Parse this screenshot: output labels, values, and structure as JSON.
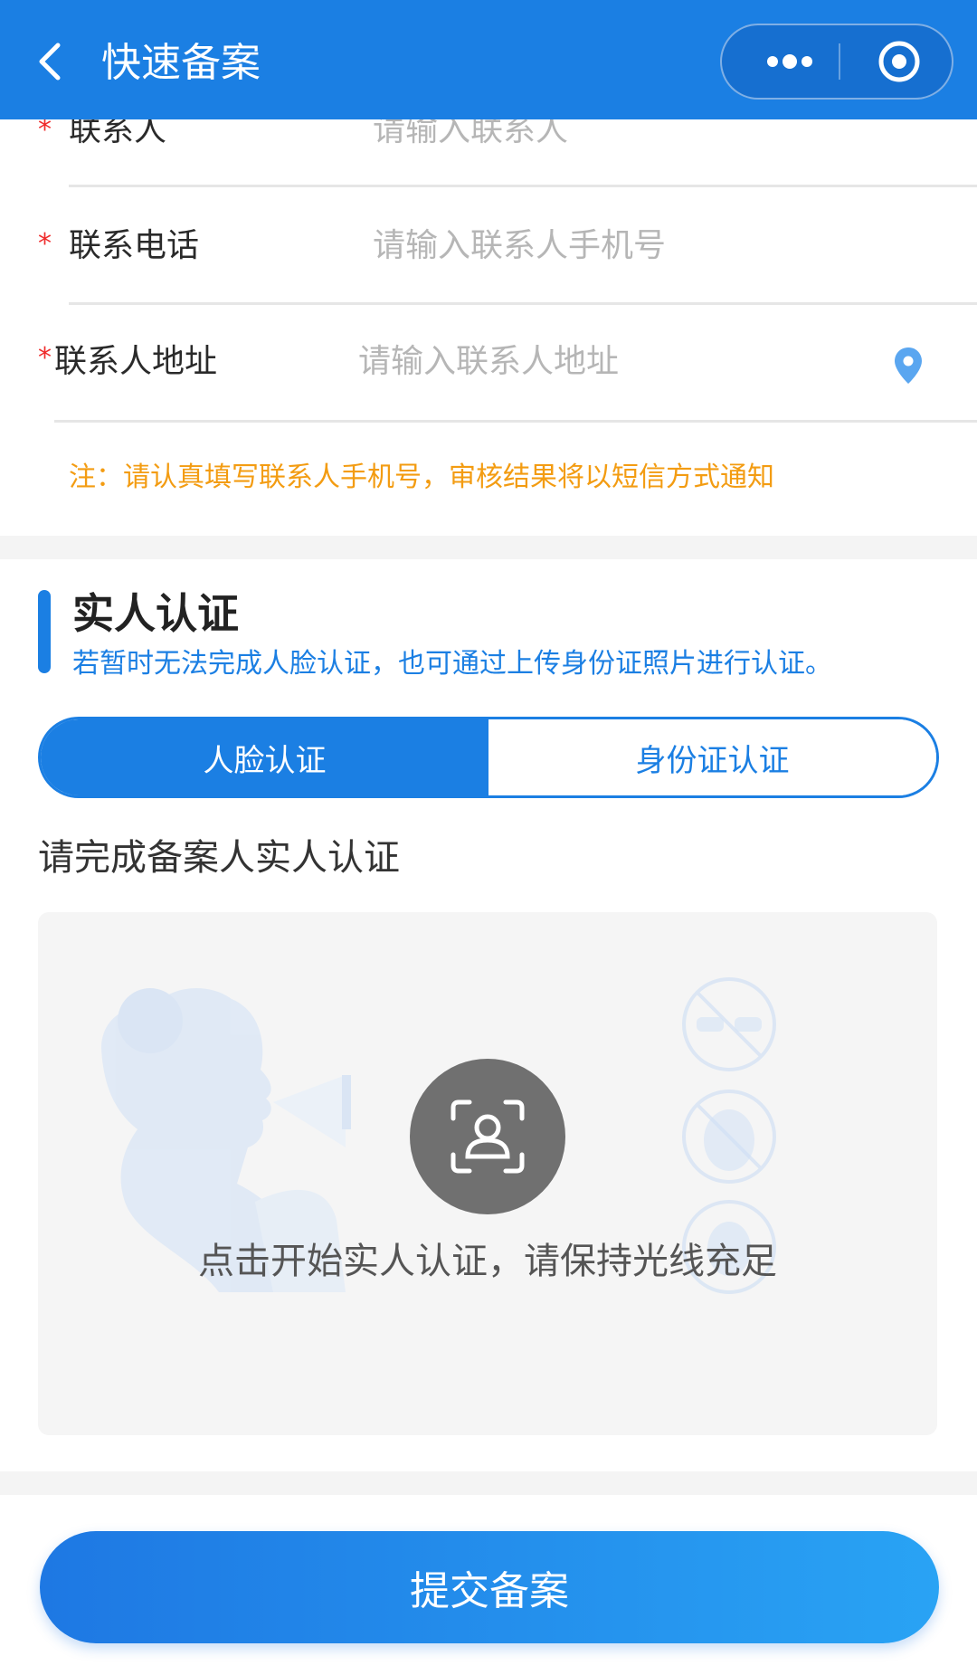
{
  "nav": {
    "title": "快速备案",
    "back_icon": "chevron-left-icon",
    "more_icon": "more-dots-icon",
    "close_icon": "target-circle-icon"
  },
  "form": {
    "contact_name": {
      "required_mark": "*",
      "label": "联系人",
      "placeholder": "请输入联系人",
      "value": ""
    },
    "contact_phone": {
      "required_mark": "*",
      "label": "联系电话",
      "placeholder": "请输入联系人手机号",
      "value": ""
    },
    "contact_address": {
      "required_mark": "*",
      "label": "联系人地址",
      "placeholder": "请输入联系人地址",
      "value": "",
      "icon": "location-pin-icon"
    },
    "note": "注：请认真填写联系人手机号，审核结果将以短信方式通知"
  },
  "verification": {
    "title": "实人认证",
    "subtitle": "若暂时无法完成人脸认证，也可通过上传身份证照片进行认证。",
    "tabs": [
      {
        "label": "人脸认证",
        "active": true
      },
      {
        "label": "身份证认证",
        "active": false
      }
    ],
    "prompt": "请完成备案人实人认证",
    "face_hint": "点击开始实人认证，请保持光线充足",
    "face_icon": "face-scan-icon"
  },
  "submit_label": "提交备案",
  "colors": {
    "primary": "#1b7fe3",
    "required": "#ef2b2b",
    "note": "#f39c12",
    "placeholder": "#b6b6b6"
  }
}
